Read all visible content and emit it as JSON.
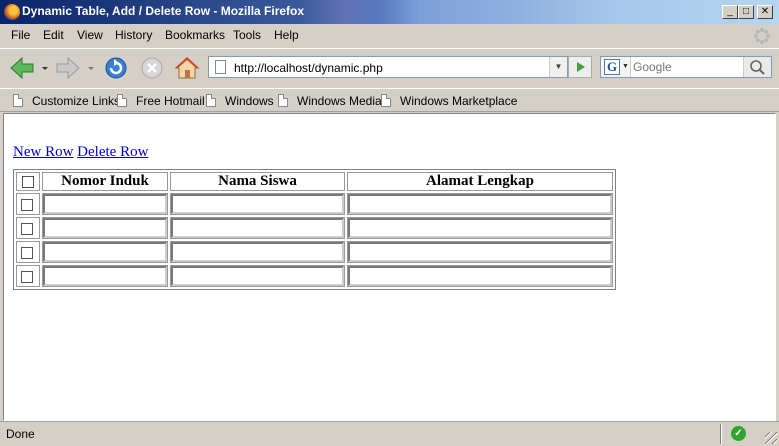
{
  "window": {
    "title": "Dynamic Table, Add / Delete Row - Mozilla Firefox",
    "min_glyph": "_",
    "max_glyph": "□",
    "close_glyph": "✕"
  },
  "menu": [
    "File",
    "Edit",
    "View",
    "History",
    "Bookmarks",
    "Tools",
    "Help"
  ],
  "nav": {
    "url": "http://localhost/dynamic.php",
    "search_placeholder": "Google",
    "search_engine_glyph": "G"
  },
  "bookmarks": [
    "Customize Links",
    "Free Hotmail",
    "Windows",
    "Windows Media",
    "Windows Marketplace"
  ],
  "page": {
    "new_row_link": "New Row",
    "delete_row_link": "Delete Row",
    "table": {
      "headers": [
        "Nomor Induk",
        "Nama Siswa",
        "Alamat Lengkap"
      ],
      "rows": [
        {
          "checked": false,
          "nomor_induk": "",
          "nama_siswa": "",
          "alamat_lengkap": ""
        },
        {
          "checked": false,
          "nomor_induk": "",
          "nama_siswa": "",
          "alamat_lengkap": ""
        },
        {
          "checked": false,
          "nomor_induk": "",
          "nama_siswa": "",
          "alamat_lengkap": ""
        },
        {
          "checked": false,
          "nomor_induk": "",
          "nama_siswa": "",
          "alamat_lengkap": ""
        }
      ]
    }
  },
  "status": {
    "text": "Done",
    "ok_glyph": "✓"
  },
  "colors": {
    "link": "#0000cc",
    "chrome": "#d4d0c8",
    "title_bar": "#0a246a"
  },
  "icons": [
    "firefox-logo-icon",
    "back-icon",
    "forward-icon",
    "reload-icon",
    "stop-icon",
    "home-icon",
    "page-icon",
    "go-icon",
    "search-magnifier-icon",
    "throbber-icon",
    "status-ok-icon"
  ]
}
